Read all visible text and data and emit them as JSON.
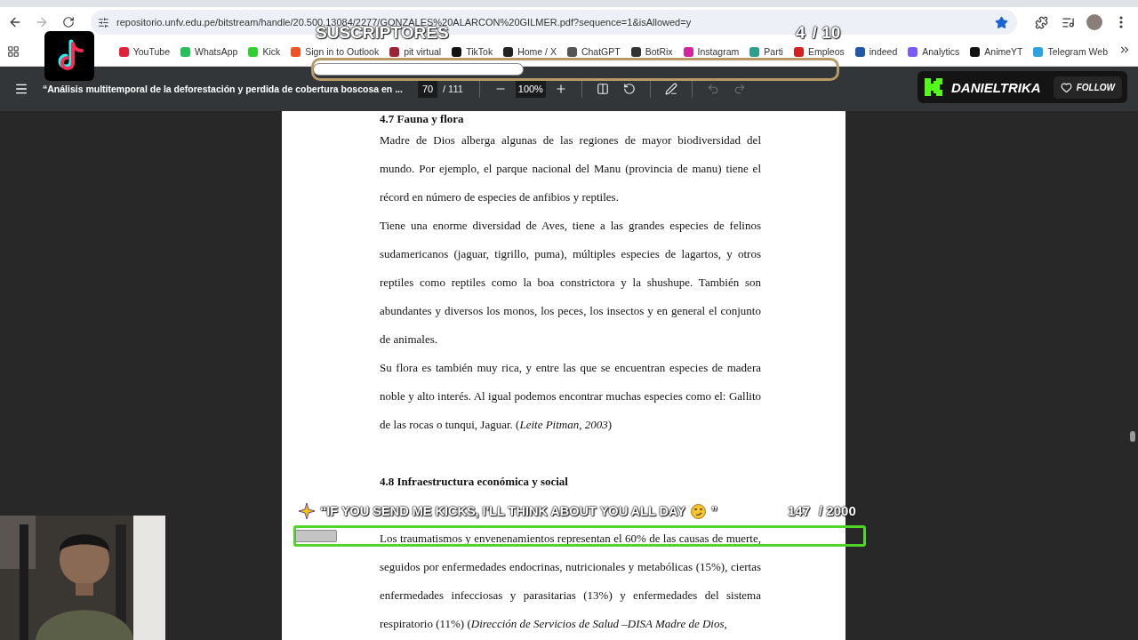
{
  "browser": {
    "url": "repositorio.unfv.edu.pe/bitstream/handle/20.500.13084/2277/GONZALES%20ALARCON%20GILMER.pdf?sequence=1&isAllowed=y",
    "bookmarked": true
  },
  "bookmarks": [
    {
      "label": "YouTube",
      "color": "#e5213a"
    },
    {
      "label": "WhatsApp",
      "color": "#25c25a"
    },
    {
      "label": "Kick",
      "color": "#2fd12f"
    },
    {
      "label": "Sign in to Outlook",
      "color": "#f25022"
    },
    {
      "label": "pit virtual",
      "color": "#9b2335"
    },
    {
      "label": "TikTok",
      "color": "#111111"
    },
    {
      "label": "Home / X",
      "color": "#222222"
    },
    {
      "label": "ChatGPT",
      "color": "#555555"
    },
    {
      "label": "BotRix",
      "color": "#333333"
    },
    {
      "label": "Instagram",
      "color": "#d6249f"
    },
    {
      "label": "Parti",
      "color": "#2e9e8f"
    },
    {
      "label": "Empleos",
      "color": "#d42020"
    },
    {
      "label": "indeed",
      "color": "#2557a7"
    },
    {
      "label": "Analytics",
      "color": "#7a5af8"
    },
    {
      "label": "AnimeYT",
      "color": "#111111"
    },
    {
      "label": "Telegram Web",
      "color": "#2aa3e0"
    }
  ],
  "pdf_toolbar": {
    "title": "“Análisis multitemporal de la deforestación y perdida de cobertura boscosa en ...",
    "page": "70",
    "page_count": "/ 111",
    "zoom": "100%"
  },
  "document": {
    "blocks": [
      {
        "kind": "heading",
        "text": "4.7 Fauna y flora"
      },
      {
        "kind": "paragraph",
        "text": "Madre de Dios alberga algunas de las regiones de mayor biodiversidad del mundo. Por ejemplo, el parque nacional del Manu (provincia de manu) tiene el récord en número de especies de anfibios y reptiles."
      },
      {
        "kind": "paragraph",
        "text": "Tiene una enorme diversidad de Aves, tiene a las grandes especies de felinos sudamericanos (jaguar, tigrillo, puma), múltiples especies de lagartos, y otros reptiles como reptiles como la boa constrictora y la shushupe. También son abundantes y diversos los monos, los peces, los insectos y en general el conjunto de animales."
      },
      {
        "kind": "paragraph",
        "text": "Su flora es también muy rica, y entre las que se encuentran especies de madera noble y alto interés. Al igual podemos encontrar muchas especies como el: Gallito de las rocas o tunqui, Jaguar. (*Leite Pitman, 2003*)"
      },
      {
        "kind": "heading",
        "text": "4.8 Infraestructura económica y social"
      },
      {
        "kind": "paragraph",
        "text": "Los traumatismos y envenenamientos representan el 60% de las causas de muerte, seguidos por enfermedades endocrinas, nutricionales y metabólicas (15%), ciertas enfermedades infecciosas y parasitarias (13%) y enfermedades del sistema respiratorio (11%) (*Dirección de Servicios de Salud –DISA Madre de Dios,*"
      }
    ]
  },
  "subscriber_goal": {
    "label": "SUSCRIPTORES",
    "count": "4",
    "target": "/ 10",
    "level": 0.4
  },
  "kick_follow": {
    "channel": "DANIELTRIKA",
    "button": "FOLLOW"
  },
  "kick_goal": {
    "message": "“IF YOU SEND ME KICKS, I'LL THINK ABOUT YOU ALL DAY",
    "closing": "”",
    "count": "147",
    "target": "/ 2000",
    "level": 0.07
  }
}
